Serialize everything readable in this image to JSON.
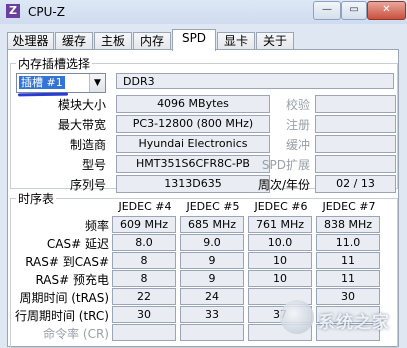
{
  "window": {
    "title": "CPU-Z",
    "icon_glyph": "Z"
  },
  "tabs": [
    {
      "label": "处理器"
    },
    {
      "label": "缓存"
    },
    {
      "label": "主板"
    },
    {
      "label": "内存"
    },
    {
      "label": "SPD",
      "active": true
    },
    {
      "label": "显卡"
    },
    {
      "label": "关于"
    }
  ],
  "slot_group": {
    "title": "内存插槽选择",
    "selected_slot": "插槽 #1",
    "type": "DDR3",
    "rows": [
      {
        "label": "模块大小",
        "value": "4096 MBytes",
        "right_label": "校验",
        "right_value": ""
      },
      {
        "label": "最大带宽",
        "value": "PC3-12800 (800 MHz)",
        "right_label": "注册",
        "right_value": ""
      },
      {
        "label": "制造商",
        "value": "Hyundai Electronics",
        "right_label": "缓冲",
        "right_value": ""
      },
      {
        "label": "型号",
        "value": "HMT351S6CFR8C-PB",
        "right_label": "SPD扩展",
        "right_value": ""
      },
      {
        "label": "序列号",
        "value": "1313D635",
        "right_label": "周次/年份",
        "right_value": "02 / 13"
      }
    ]
  },
  "timing_group": {
    "title": "时序表",
    "columns": [
      "JEDEC #4",
      "JEDEC #5",
      "JEDEC #6",
      "JEDEC #7"
    ],
    "rows": [
      {
        "label": "频率",
        "values": [
          "609 MHz",
          "685 MHz",
          "761 MHz",
          "838 MHz"
        ]
      },
      {
        "label": "CAS# 延迟",
        "values": [
          "8.0",
          "9.0",
          "10.0",
          "11.0"
        ]
      },
      {
        "label": "RAS# 到CAS#",
        "values": [
          "8",
          "9",
          "10",
          "11"
        ]
      },
      {
        "label": "RAS# 预充电",
        "values": [
          "8",
          "9",
          "10",
          "11"
        ]
      },
      {
        "label": "周期时间 (tRAS)",
        "values": [
          "22",
          "24",
          "",
          "30"
        ]
      },
      {
        "label": "行周期时间 (tRC)",
        "values": [
          "30",
          "33",
          "37",
          ""
        ]
      },
      {
        "label": "命令率 (CR)",
        "values": [
          "",
          "",
          "",
          ""
        ],
        "dim": true
      }
    ]
  },
  "watermark": {
    "text": "系统之家"
  }
}
